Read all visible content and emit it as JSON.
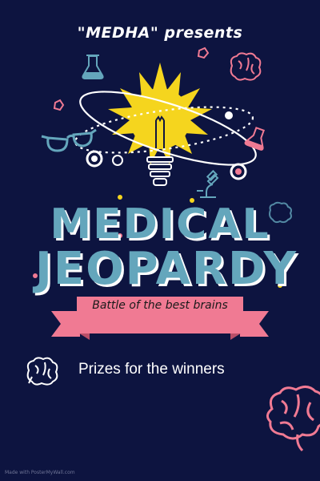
{
  "poster": {
    "presenter_line": "\"MEDHA\"  presents",
    "title_line_1": "MEDICAL",
    "title_line_2": "JEOPARDY",
    "tagline": "Battle of the best brains",
    "prizes_text": "Prizes for the winners",
    "watermark": "Made with PosterMyWall.com"
  },
  "colors": {
    "background": "#0d1440",
    "title": "#64a6bc",
    "ribbon": "#f07a93",
    "bulb_glow": "#f5d51e",
    "accent_pink": "#f07a93"
  },
  "icons": [
    "light-bulb-icon",
    "flask-icon",
    "brain-icon",
    "glasses-icon",
    "microscope-icon",
    "pentagon-icon",
    "orbit-icon"
  ]
}
